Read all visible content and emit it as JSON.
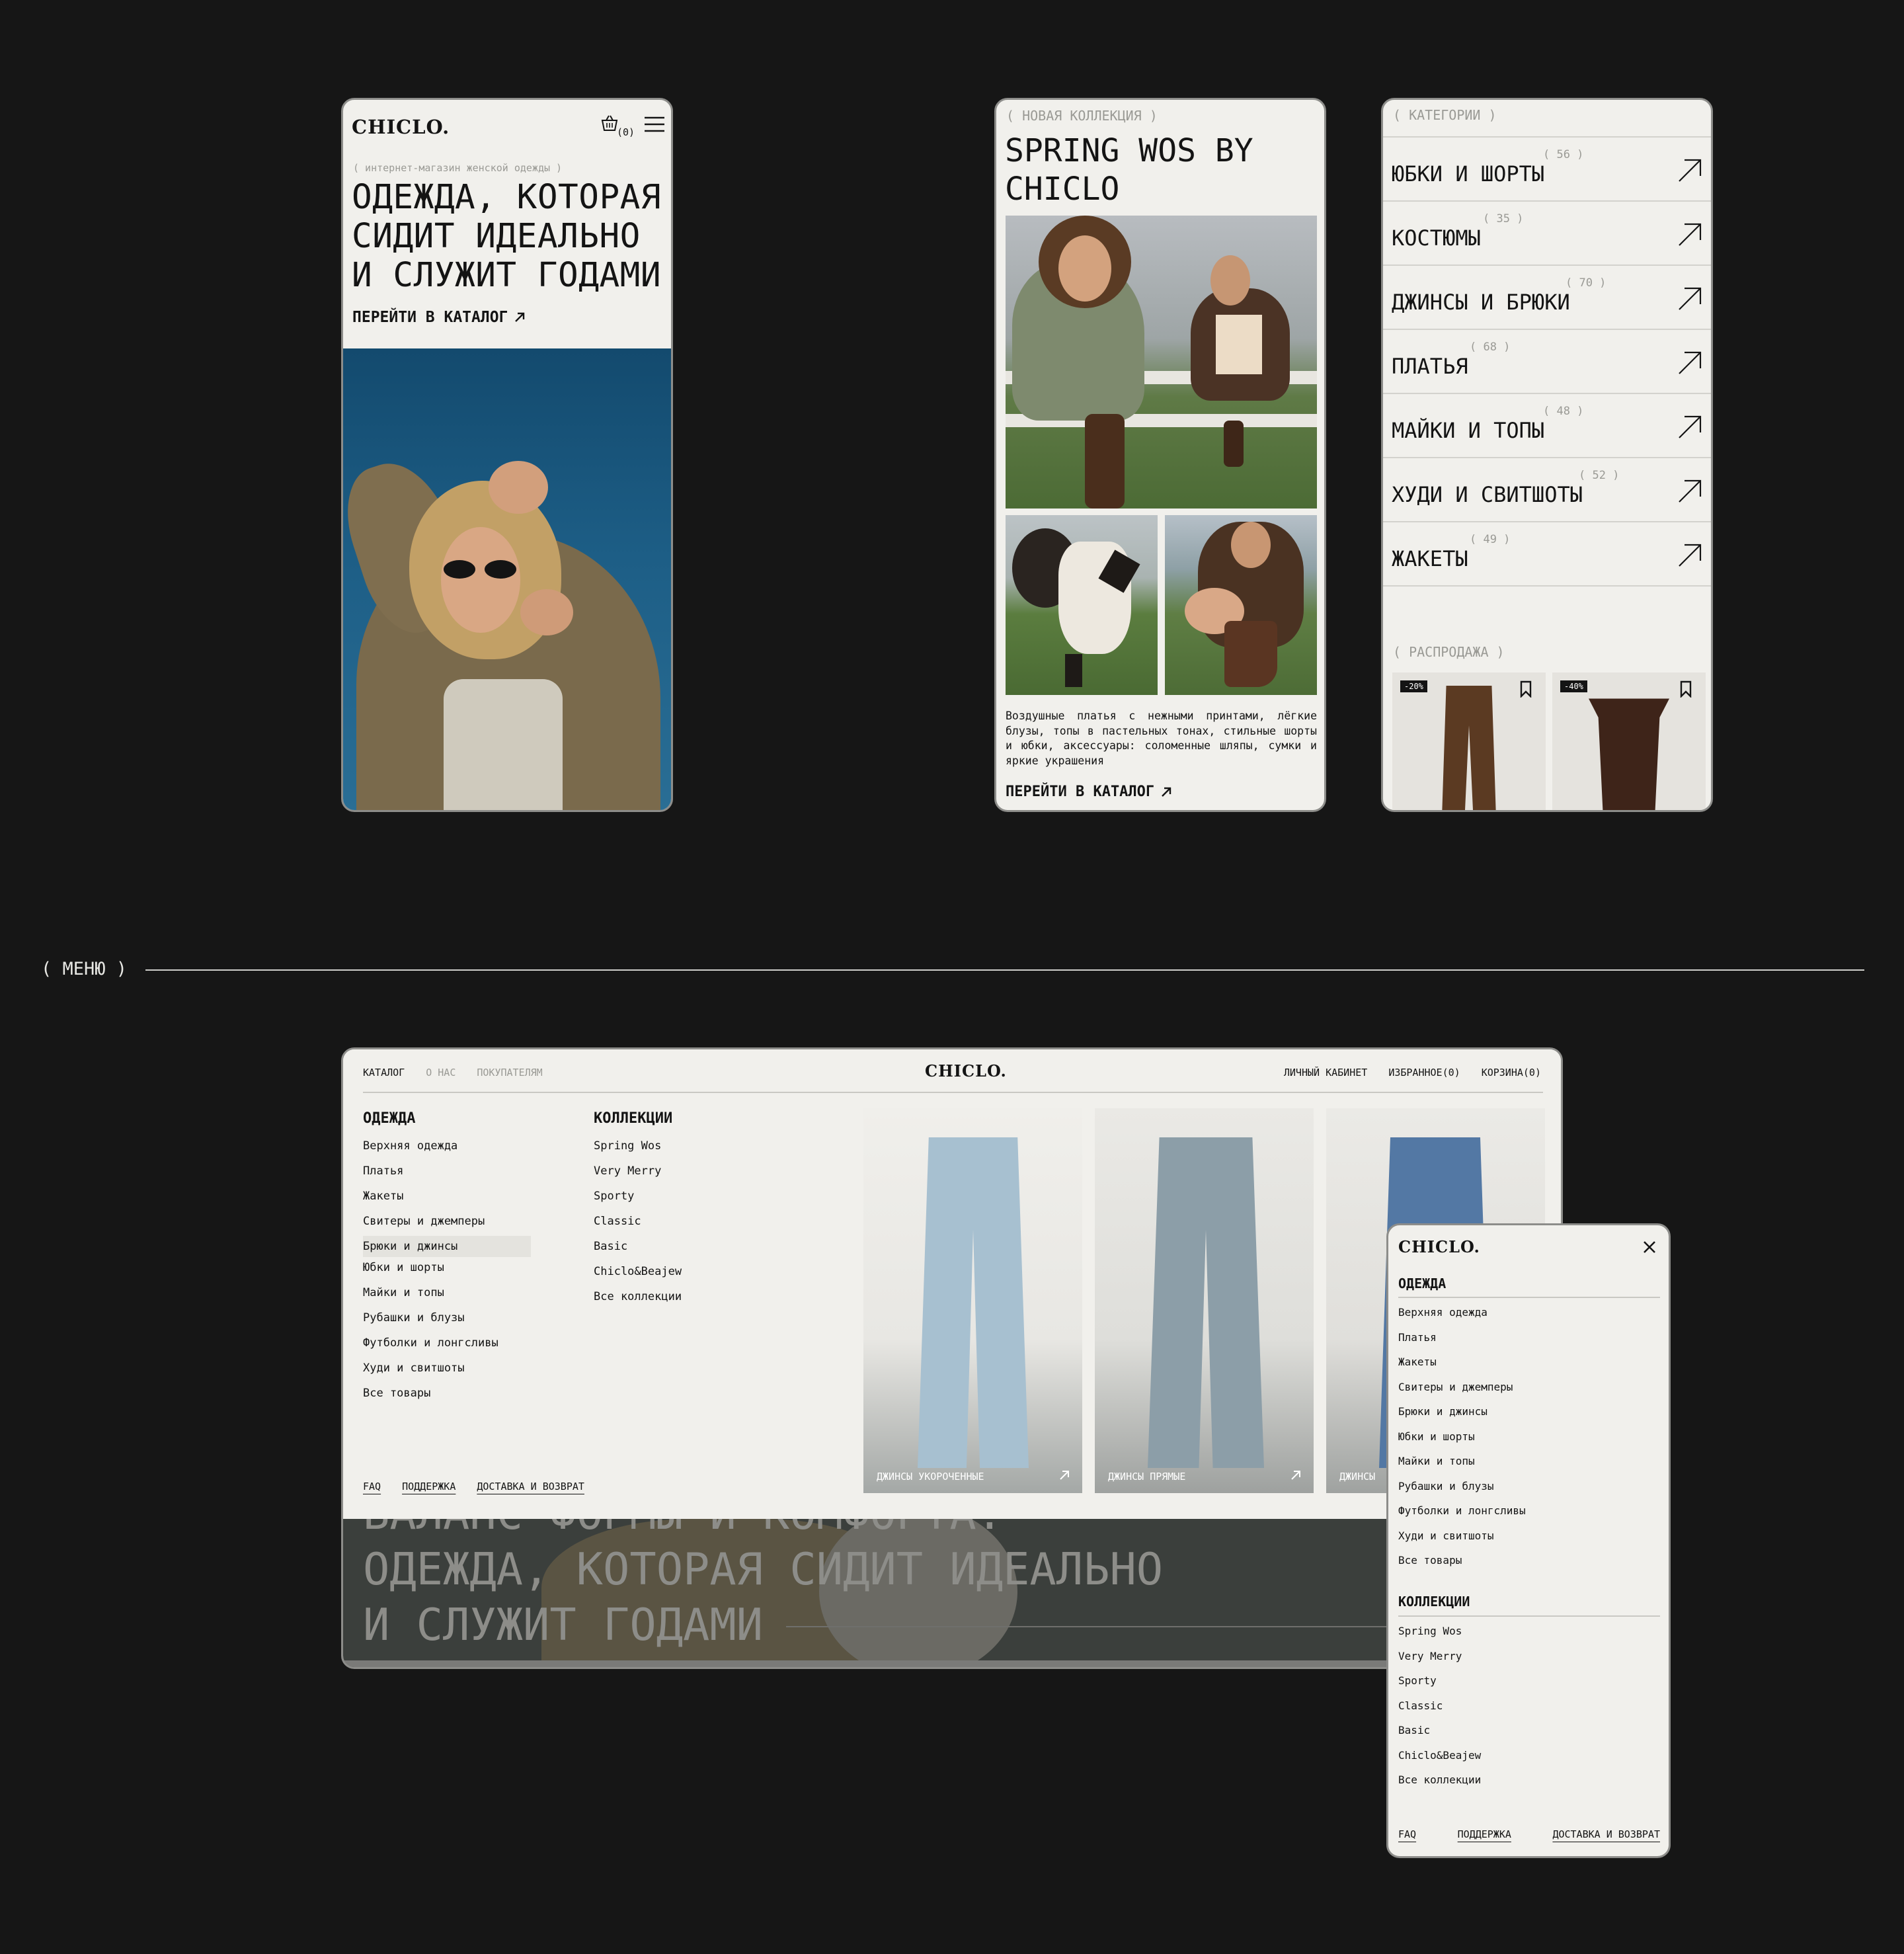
{
  "colors": {
    "background": "#161616",
    "panel": "#f1f0ec",
    "text": "#141414",
    "muted": "#9a9a95",
    "sky": "#1b5a86",
    "grass": "#567b3e"
  },
  "hero_mobile": {
    "logo": "CHICLO.",
    "cart_count": "(0)",
    "tagline": "( интернет-магазин женской одежды )",
    "headline_1": "ОДЕЖДА, КОТОРАЯ",
    "headline_2": "СИДИТ ИДЕАЛЬНО",
    "headline_3": "И СЛУЖИТ ГОДАМИ",
    "cta": "ПЕРЕЙТИ В КАТАЛОГ"
  },
  "collection_mobile": {
    "label": "( НОВАЯ КОЛЛЕКЦИЯ )",
    "title_1": "SPRING WOS BY",
    "title_2": "CHICLO",
    "description": "Воздушные платья с нежными принтами, лёгкие блузы, топы в пастельных тонах, стильные шорты и юбки, аксессуары: соломенные шляпы, сумки и яркие украшения",
    "cta": "ПЕРЕЙТИ В КАТАЛОГ"
  },
  "categories_mobile": {
    "label": "( КАТЕГОРИИ )",
    "items": [
      {
        "name": "ЮБКИ И ШОРТЫ",
        "count": "( 56 )"
      },
      {
        "name": "КОСТЮМЫ",
        "count": "( 35 )"
      },
      {
        "name": "ДЖИНСЫ И БРЮКИ",
        "count": "( 70 )"
      },
      {
        "name": "ПЛАТЬЯ",
        "count": "( 68 )"
      },
      {
        "name": "МАЙКИ И ТОПЫ",
        "count": "( 48 )"
      },
      {
        "name": "ХУДИ И СВИТШОТЫ",
        "count": "( 52 )"
      },
      {
        "name": "ЖАКЕТЫ",
        "count": "( 49 )"
      }
    ],
    "sale_label": "( РАСПРОДАЖА )",
    "sale_items": [
      {
        "badge": "-20%"
      },
      {
        "badge": "-40%"
      }
    ]
  },
  "section_divider": {
    "label": "( МЕНЮ )"
  },
  "desktop_menu": {
    "nav": [
      "КАТАЛОГ",
      "О НАС",
      "ПОКУПАТЕЛЯМ"
    ],
    "logo": "CHICLO.",
    "account": "ЛИЧНЫЙ КАБИНЕТ",
    "favorites": "ИЗБРАННОЕ(0)",
    "cart": "КОРЗИНА(0)",
    "clothes_heading": "ОДЕЖДА",
    "clothes": [
      "Верхняя одежда",
      "Платья",
      "Жакеты",
      "Свитеры и джемперы",
      "Брюки и джинсы",
      "Юбки и шорты",
      "Майки и топы",
      "Рубашки и блузы",
      "Футболки и лонгсливы",
      "Худи и свитшоты",
      "Все товары"
    ],
    "collections_heading": "КОЛЛЕКЦИИ",
    "collections": [
      "Spring Wos",
      "Very Merry",
      "Sporty",
      "Classic",
      "Basic",
      "Chiclo&Beajew",
      "Все коллекции"
    ],
    "products": [
      {
        "label": "ДЖИНСЫ УКОРОЧЕННЫЕ"
      },
      {
        "label": "ДЖИНСЫ ПРЯМЫЕ"
      },
      {
        "label": "ДЖИНСЫ"
      }
    ],
    "footer_links": [
      "FAQ",
      "ПОДДЕРЖКА",
      "ДОСТАВКА И ВОЗВРАТ"
    ],
    "bg_line_0": "БАЛАНС ФОРМЫ И КОМФОРТА.",
    "bg_line_1": "ОДЕЖДА, КОТОРАЯ СИДИТ ИДЕАЛЬНО",
    "bg_line_2": "И СЛУЖИТ ГОДАМИ"
  },
  "mobile_menu": {
    "logo": "CHICLO.",
    "clothes_heading": "ОДЕЖДА",
    "clothes": [
      "Верхняя одежда",
      "Платья",
      "Жакеты",
      "Свитеры и джемперы",
      "Брюки и джинсы",
      "Юбки и шорты",
      "Майки и топы",
      "Рубашки и блузы",
      "Футболки и лонгсливы",
      "Худи и свитшоты",
      "Все товары"
    ],
    "collections_heading": "КОЛЛЕКЦИИ",
    "collections": [
      "Spring Wos",
      "Very Merry",
      "Sporty",
      "Classic",
      "Basic",
      "Chiclo&Beajew",
      "Все коллекции"
    ],
    "footer_links": [
      "FAQ",
      "ПОДДЕРЖКА",
      "ДОСТАВКА И ВОЗВРАТ"
    ]
  }
}
